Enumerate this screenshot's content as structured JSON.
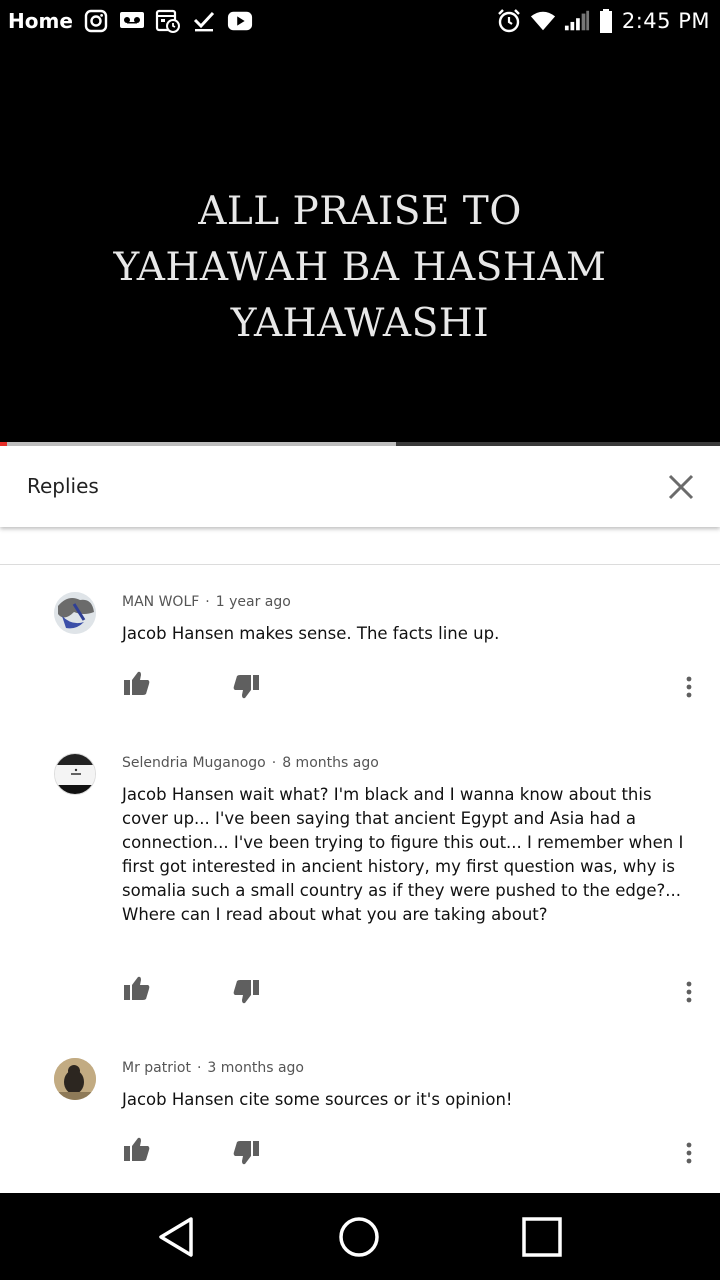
{
  "status_bar": {
    "left_label": "Home",
    "time": "2:45 PM",
    "left_icons": [
      "instagram-icon",
      "voicemail-icon",
      "calendar-icon",
      "check-download-icon",
      "youtube-icon"
    ],
    "right_icons": [
      "alarm-icon",
      "wifi-icon",
      "signal-icon",
      "battery-icon"
    ]
  },
  "video": {
    "title_lines": [
      "ALL PRAISE TO",
      "YAHAWAH BA HASHAM",
      "YAHAWASHI"
    ],
    "progress_played_fraction": 0.01,
    "progress_buffered_fraction": 0.55,
    "accent_color": "#e52d27"
  },
  "replies": {
    "title": "Replies",
    "close_icon": "close-icon",
    "comments": [
      {
        "author": "MAN WOLF",
        "time": "1 year ago",
        "text": "Jacob Hansen makes sense. The facts line up."
      },
      {
        "author": "Selendria Muganogo",
        "time": "8 months ago",
        "text": "Jacob Hansen wait what? I'm black and I wanna know about this cover up... I've been saying that ancient Egypt and Asia had a connection... I've been trying to figure this out... I remember when I first got interested in ancient history, my first question was, why is somalia such a small country as if they were pushed to the edge?... Where can I read about what you are taking about?"
      },
      {
        "author": "Mr patriot",
        "time": "3 months ago",
        "text": "Jacob Hansen cite some sources or it's opinion!"
      }
    ]
  },
  "nav_bar": {
    "icons": [
      "back-icon",
      "home-icon",
      "recents-icon"
    ]
  }
}
